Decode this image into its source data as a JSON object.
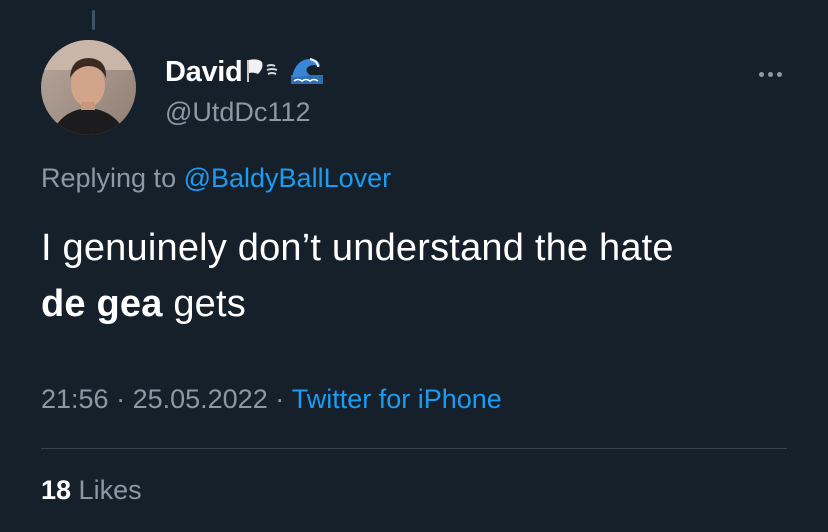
{
  "tweet": {
    "author": {
      "display_name": "David",
      "handle": "@UtdDc112",
      "avatar": "avatar-photo",
      "name_emojis": [
        "dash-flag-icon",
        "wave-icon"
      ]
    },
    "replying_to_prefix": "Replying to ",
    "replying_to_handle": "@BaldyBallLover",
    "text_line1": "I genuinely don’t understand the hate",
    "text_bold": "de gea",
    "text_rest": " gets",
    "time": "21:56",
    "separator": " · ",
    "date": "25.05.2022",
    "source": "Twitter for iPhone",
    "likes_count": "18",
    "likes_label": " Likes"
  },
  "colors": {
    "background": "#15202b",
    "text": "#ffffff",
    "secondary": "#8b98a5",
    "accent": "#1d9bf0",
    "divider": "#38444d"
  }
}
